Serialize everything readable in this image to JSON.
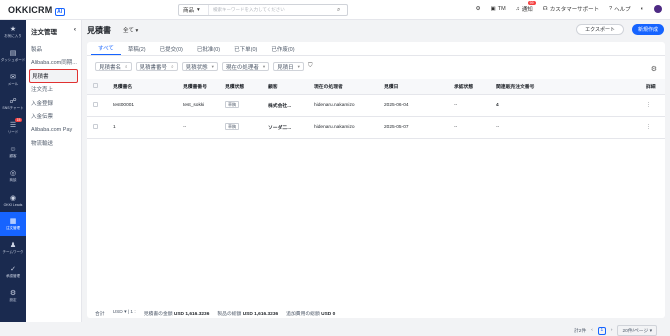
{
  "app": {
    "logo": "OKKICRM",
    "logo_badge": "AI"
  },
  "search": {
    "scope": "商品",
    "placeholder": "検索キーワードを入力してください"
  },
  "topbar": {
    "items": [
      {
        "icon": "gear-icon",
        "label": ""
      },
      {
        "icon": "calendar-icon",
        "label": "TM"
      },
      {
        "icon": "bell-icon",
        "label": "通知",
        "badge": "99"
      },
      {
        "icon": "headset-icon",
        "label": "カスタマーサポート"
      },
      {
        "icon": "help-icon",
        "label": "ヘルプ"
      }
    ]
  },
  "rail": [
    {
      "icon": "★",
      "label": "お気に入り"
    },
    {
      "icon": "▤",
      "label": "ダッシュボード"
    },
    {
      "icon": "✉",
      "label": "メール"
    },
    {
      "icon": "☍",
      "label": "SNSチャート"
    },
    {
      "icon": "☰",
      "label": "リード",
      "badge": "15"
    },
    {
      "icon": "☺",
      "label": "顧客"
    },
    {
      "icon": "◎",
      "label": "商談"
    },
    {
      "icon": "◉",
      "label": "OKKI Leads"
    },
    {
      "icon": "▦",
      "label": "注文管理",
      "active": true
    },
    {
      "icon": "♟",
      "label": "チームワーク"
    },
    {
      "icon": "✓",
      "label": "承認管理"
    },
    {
      "icon": "⚙",
      "label": "設定"
    }
  ],
  "submenu": {
    "title": "注文管理",
    "items": [
      "製品",
      "Alibaba.com同期...",
      "見積書",
      "注文売上",
      "入金登録",
      "入金伝票",
      "Alibaba.com Pay",
      "物流輸送"
    ],
    "active_index": 2
  },
  "page": {
    "title": "見積書",
    "view": "全て",
    "export": "エクスポート",
    "new": "新規作成"
  },
  "tabs": [
    {
      "label": "すべて",
      "active": true
    },
    {
      "label": "草稿(2)"
    },
    {
      "label": "已提交(0)"
    },
    {
      "label": "已批准(0)"
    },
    {
      "label": "已下单(0)"
    },
    {
      "label": "已作废(0)"
    }
  ],
  "filters": [
    "見積書名",
    "見積書番号",
    "見積状態",
    "現在の処理者",
    "見積日"
  ],
  "table": {
    "headers": [
      "",
      "見積書名",
      "見積書番号",
      "見積状態",
      "顧客",
      "現在の処理者",
      "見積日",
      "承認状態",
      "関連販売注文番号",
      "詳細"
    ],
    "rows": [
      {
        "name": "test00001",
        "no": "test_sokki",
        "status": "草稿",
        "customer": "株式会社...",
        "handler": "hidenaru.nakamizo",
        "date": "2025-06-04",
        "approval": "--",
        "order": "4",
        "more": "⋮"
      },
      {
        "name": "1",
        "no": "--",
        "status": "草稿",
        "customer": "ソーダ二...",
        "handler": "hidenaru.nakamizo",
        "date": "2025-05-07",
        "approval": "--",
        "order": "--",
        "more": "⋮"
      }
    ]
  },
  "summary": {
    "label": "合計",
    "currency": "USD",
    "sep": "1",
    "a_label": "見積書の金額",
    "a_val": "USD 1,616.3236",
    "b_label": "製品の総額",
    "b_val": "USD 1,616.3236",
    "c_label": "追加費用の総額",
    "c_val": "USD 0"
  },
  "pager": {
    "total": "計2件",
    "page": "1",
    "size": "20件/ページ"
  }
}
